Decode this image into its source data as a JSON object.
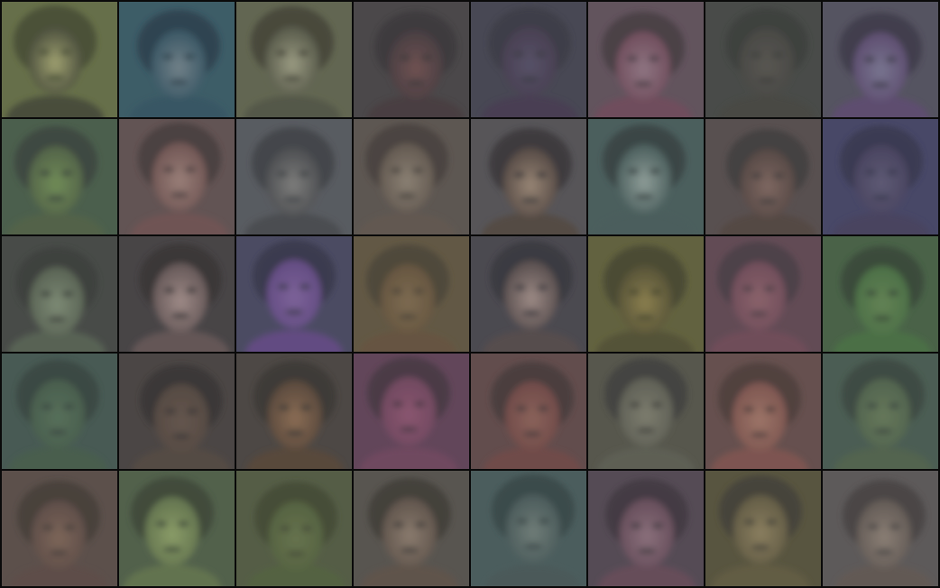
{
  "grid": {
    "rows": 5,
    "cols": 8,
    "tiles": [
      {
        "bg": "#5f6a3c",
        "face": "#a2a46a",
        "hair": "#3e4528",
        "shadow": "#3a3f2a"
      },
      {
        "bg": "#2d5360",
        "face": "#6c7f88",
        "hair": "#1d3644",
        "shadow": "#274b5c"
      },
      {
        "bg": "#5a5f46",
        "face": "#9d9e80",
        "hair": "#3a3a2c",
        "shadow": "#4a4d3a"
      },
      {
        "bg": "#3d3a3c",
        "face": "#6a4545",
        "hair": "#2f2a2d",
        "shadow": "#3a2e33"
      },
      {
        "bg": "#3a3a48",
        "face": "#4c4560",
        "hair": "#2e2e3a",
        "shadow": "#3a2f46"
      },
      {
        "bg": "#5a4854",
        "face": "#8f7080",
        "hair": "#3d3038",
        "shadow": "#6a4052"
      },
      {
        "bg": "#3b3e3b",
        "face": "#4e4b45",
        "hair": "#2f322f",
        "shadow": "#3a3a36"
      },
      {
        "bg": "#4a4858",
        "face": "#747090",
        "hair": "#302e40",
        "shadow": "#54406a"
      },
      {
        "bg": "#3e5640",
        "face": "#6b8c4c",
        "hair": "#2e3a30",
        "shadow": "#465a3a"
      },
      {
        "bg": "#5a4848",
        "face": "#9c7c74",
        "hair": "#3e3030",
        "shadow": "#6a4a48"
      },
      {
        "bg": "#4e5258",
        "face": "#7a7a78",
        "hair": "#34383c",
        "shadow": "#3e4044"
      },
      {
        "bg": "#544c46",
        "face": "#8a7e6e",
        "hair": "#3c3630",
        "shadow": "#5a4e44"
      },
      {
        "bg": "#4c4a4e",
        "face": "#9a8470",
        "hair": "#2f2c2e",
        "shadow": "#4a3c36"
      },
      {
        "bg": "#3e5654",
        "face": "#8ea09a",
        "hair": "#2c3838",
        "shadow": "#3c5452"
      },
      {
        "bg": "#4e4444",
        "face": "#7c6058",
        "hair": "#363030",
        "shadow": "#4a3a36"
      },
      {
        "bg": "#3a3a60",
        "face": "#555070",
        "hair": "#2a2a46",
        "shadow": "#3a3456"
      },
      {
        "bg": "#3a3e3a",
        "face": "#7a8a70",
        "hair": "#2e322e",
        "shadow": "#4e5a48"
      },
      {
        "bg": "#3a3638",
        "face": "#a28a86",
        "hair": "#2a2628",
        "shadow": "#5c4c4c"
      },
      {
        "bg": "#3e3e5a",
        "face": "#7a5a9c",
        "hair": "#2c2c42",
        "shadow": "#5a3e80"
      },
      {
        "bg": "#5a4e36",
        "face": "#7a6444",
        "hair": "#423a2a",
        "shadow": "#5e4a30"
      },
      {
        "bg": "#3e3c44",
        "face": "#a08a84",
        "hair": "#2c2a30",
        "shadow": "#4c4040"
      },
      {
        "bg": "#5a5a30",
        "face": "#8a7c40",
        "hair": "#3c3c22",
        "shadow": "#4a4626"
      },
      {
        "bg": "#5a3e4a",
        "face": "#8a5a64",
        "hair": "#40303a",
        "shadow": "#6a4050"
      },
      {
        "bg": "#3c5a3a",
        "face": "#5a8048",
        "hair": "#2a3c2a",
        "shadow": "#3e6a38"
      },
      {
        "bg": "#3a5048",
        "face": "#4c6a50",
        "hair": "#2a3a34",
        "shadow": "#3a5440"
      },
      {
        "bg": "#3e3836",
        "face": "#5c4a40",
        "hair": "#2c2826",
        "shadow": "#4a3c34"
      },
      {
        "bg": "#403a36",
        "face": "#8a6648",
        "hair": "#2e2a26",
        "shadow": "#4e3a2c"
      },
      {
        "bg": "#5a3850",
        "face": "#8a4a6a",
        "hair": "#3e2a38",
        "shadow": "#6a3a56"
      },
      {
        "bg": "#5a4040",
        "face": "#8a5a50",
        "hair": "#3c2e2e",
        "shadow": "#6a3c3a"
      },
      {
        "bg": "#4c4c40",
        "face": "#7a7a68",
        "hair": "#343430",
        "shadow": "#55564a"
      },
      {
        "bg": "#5e4442",
        "face": "#a07060",
        "hair": "#44302e",
        "shadow": "#7a4a44"
      },
      {
        "bg": "#3e5448",
        "face": "#5e7450",
        "hair": "#2e3c34",
        "shadow": "#465c42"
      },
      {
        "bg": "#52443e",
        "face": "#7a5e4e",
        "hair": "#3a302c",
        "shadow": "#54403a"
      },
      {
        "bg": "#46583e",
        "face": "#8aa060",
        "hair": "#303e2c",
        "shadow": "#5a6e42"
      },
      {
        "bg": "#4a5438",
        "face": "#5e6e40",
        "hair": "#384028",
        "shadow": "#4a5a32"
      },
      {
        "bg": "#4e4a44",
        "face": "#8a7868",
        "hair": "#34302c",
        "shadow": "#56483e"
      },
      {
        "bg": "#3e5454",
        "face": "#6a7a74",
        "hair": "#2c3c3c",
        "shadow": "#3c5050"
      },
      {
        "bg": "#4a3e4a",
        "face": "#8a6a78",
        "hair": "#342c34",
        "shadow": "#5e4050"
      },
      {
        "bg": "#4e4a30",
        "face": "#8a7c56",
        "hair": "#38362a",
        "shadow": "#5a5236"
      },
      {
        "bg": "#545050",
        "face": "#8a7c70",
        "hair": "#3c3838",
        "shadow": "#5a504a"
      }
    ]
  }
}
